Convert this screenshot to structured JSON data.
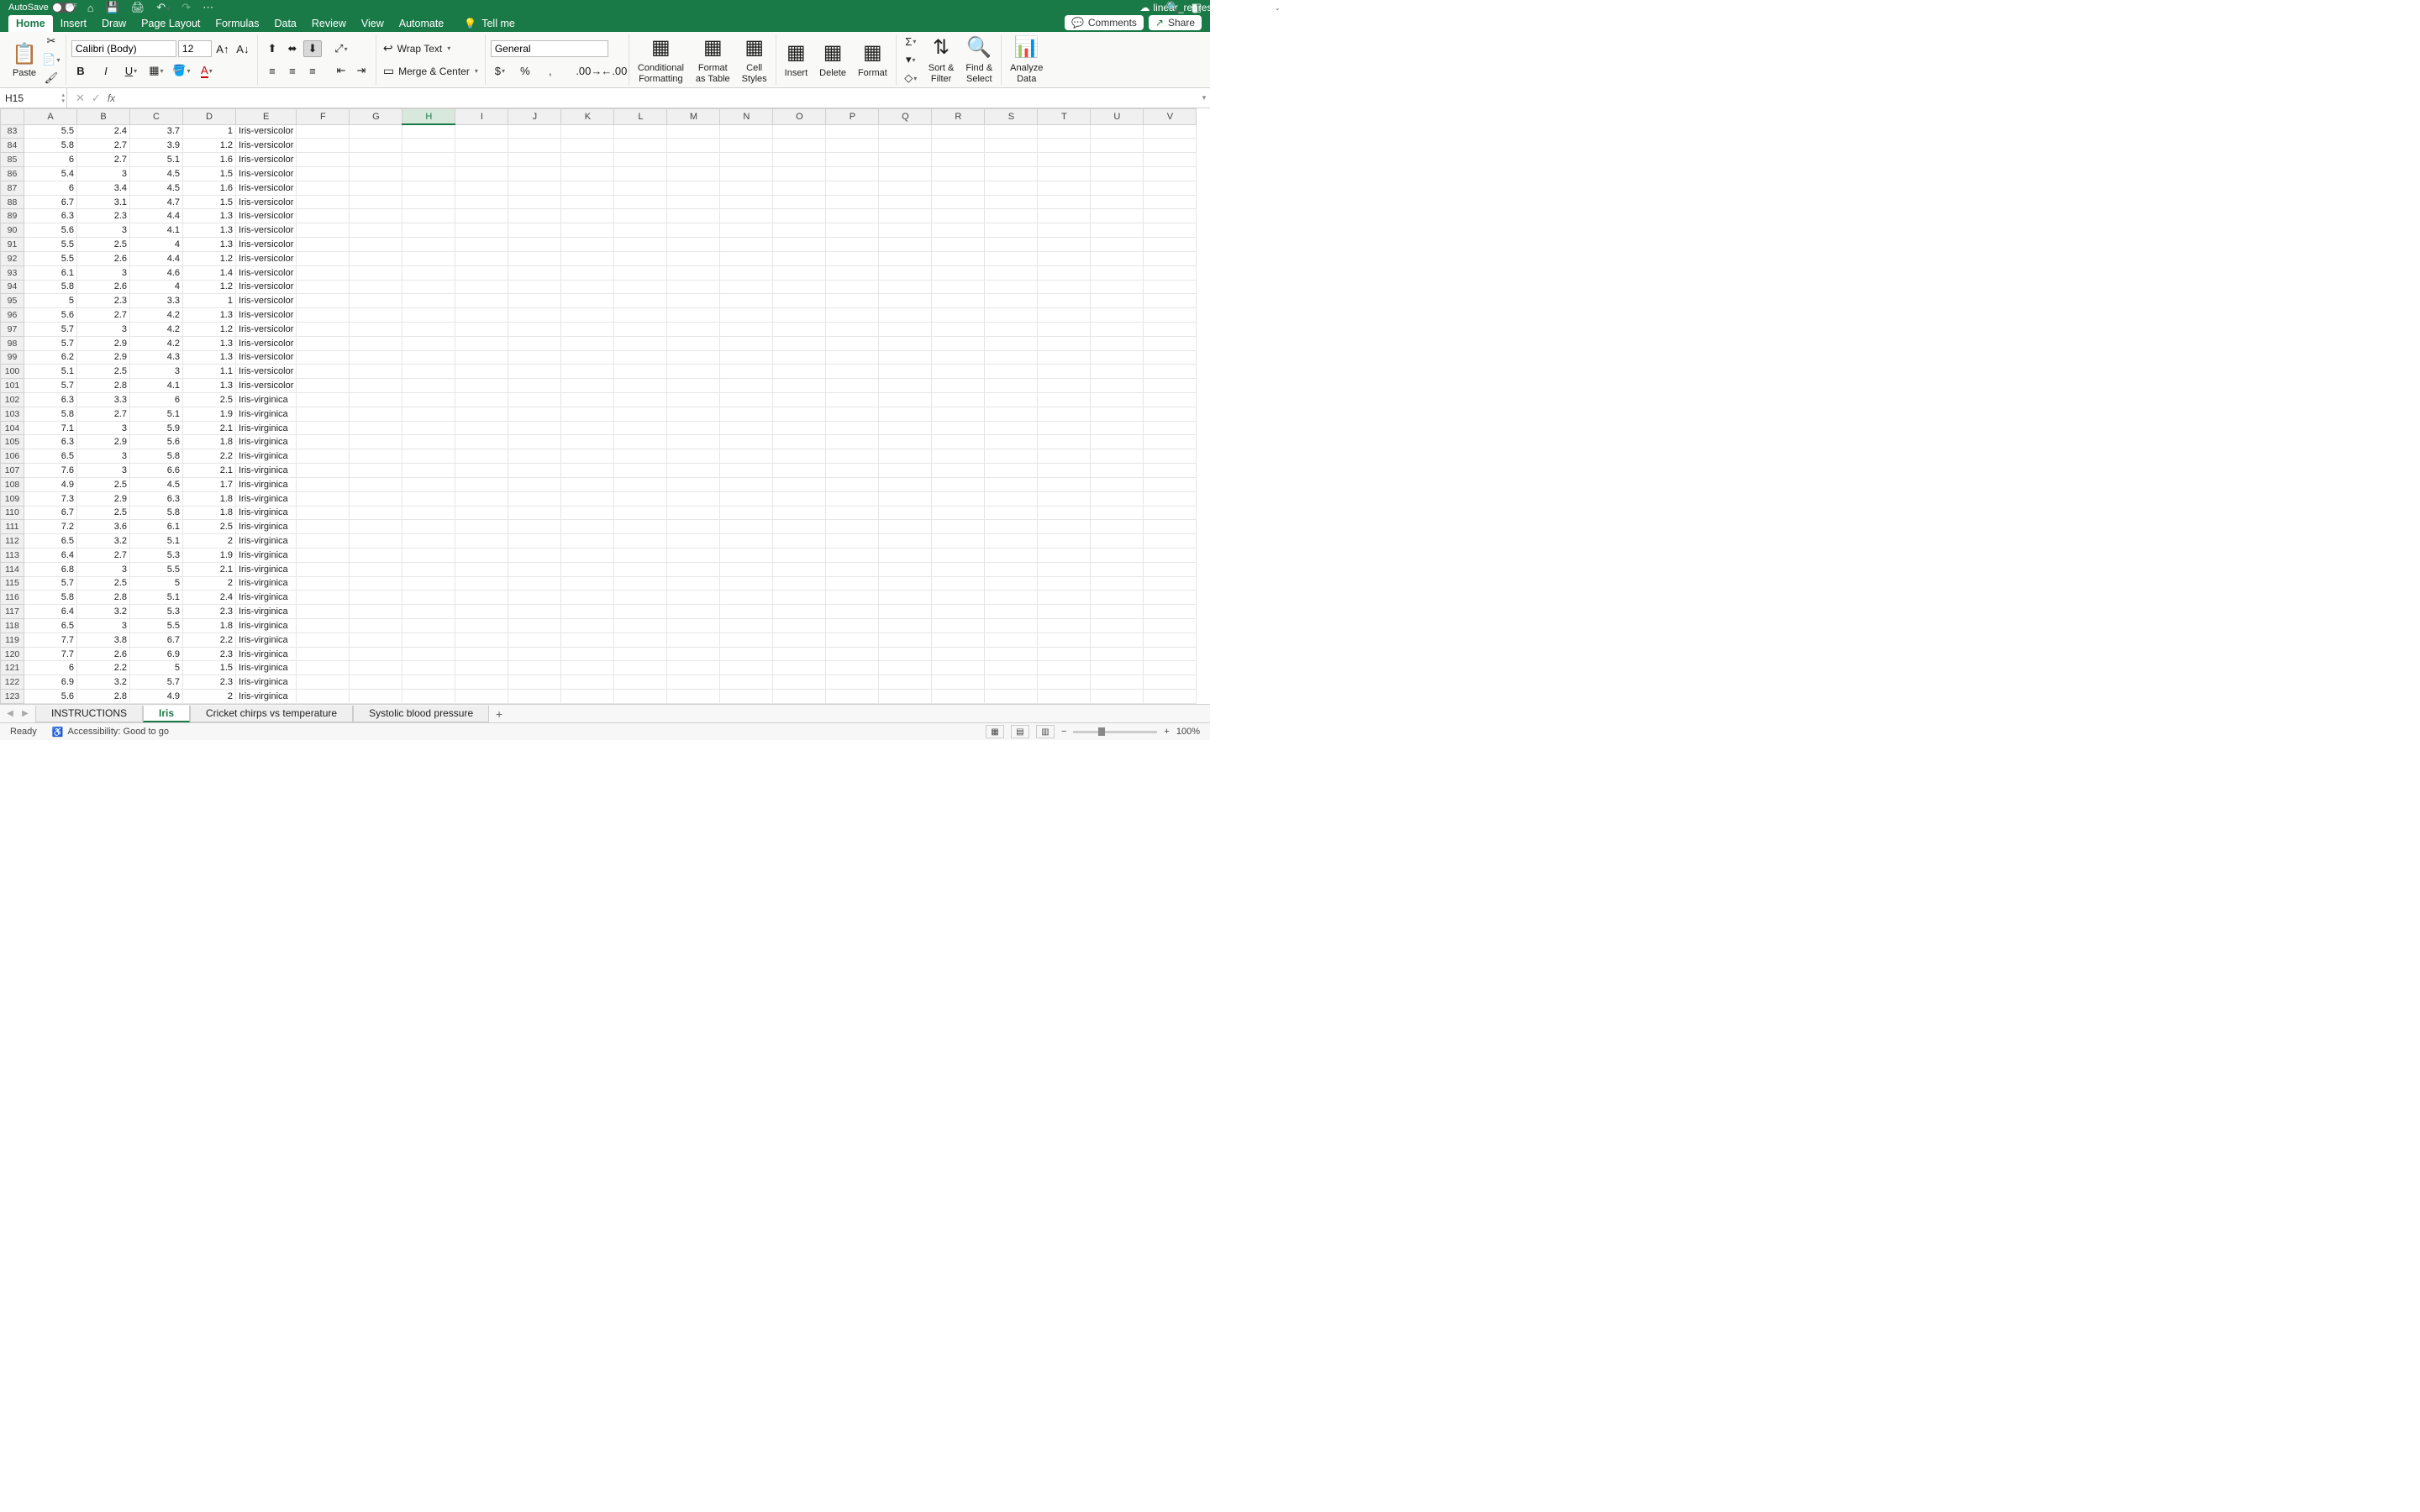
{
  "titlebar": {
    "autosave": "AutoSave",
    "toggle": "OFF",
    "filename": "linear_regression-updated"
  },
  "tabs": [
    "Home",
    "Insert",
    "Draw",
    "Page Layout",
    "Formulas",
    "Data",
    "Review",
    "View",
    "Automate"
  ],
  "tabs_active": 0,
  "tellme": "Tell me",
  "comments": "Comments",
  "share": "Share",
  "ribbon": {
    "paste": "Paste",
    "font": "Calibri (Body)",
    "size": "12",
    "wrap": "Wrap Text",
    "merge": "Merge & Center",
    "numformat": "General",
    "cond": "Conditional\nFormatting",
    "fmt_table": "Format\nas Table",
    "cell_styles": "Cell\nStyles",
    "insert": "Insert",
    "delete": "Delete",
    "format": "Format",
    "sort": "Sort &\nFilter",
    "find": "Find &\nSelect",
    "analyze": "Analyze\nData"
  },
  "namebox": "H15",
  "columns": [
    "A",
    "B",
    "C",
    "D",
    "E",
    "F",
    "G",
    "H",
    "I",
    "J",
    "K",
    "L",
    "M",
    "N",
    "O",
    "P",
    "Q",
    "R",
    "S",
    "T",
    "U",
    "V"
  ],
  "sel_col": 7,
  "rows": [
    {
      "n": 83,
      "a": 5.5,
      "b": 2.4,
      "c": 3.7,
      "d": 1,
      "e": "Iris-versicolor"
    },
    {
      "n": 84,
      "a": 5.8,
      "b": 2.7,
      "c": 3.9,
      "d": 1.2,
      "e": "Iris-versicolor"
    },
    {
      "n": 85,
      "a": 6,
      "b": 2.7,
      "c": 5.1,
      "d": 1.6,
      "e": "Iris-versicolor"
    },
    {
      "n": 86,
      "a": 5.4,
      "b": 3,
      "c": 4.5,
      "d": 1.5,
      "e": "Iris-versicolor"
    },
    {
      "n": 87,
      "a": 6,
      "b": 3.4,
      "c": 4.5,
      "d": 1.6,
      "e": "Iris-versicolor"
    },
    {
      "n": 88,
      "a": 6.7,
      "b": 3.1,
      "c": 4.7,
      "d": 1.5,
      "e": "Iris-versicolor"
    },
    {
      "n": 89,
      "a": 6.3,
      "b": 2.3,
      "c": 4.4,
      "d": 1.3,
      "e": "Iris-versicolor"
    },
    {
      "n": 90,
      "a": 5.6,
      "b": 3,
      "c": 4.1,
      "d": 1.3,
      "e": "Iris-versicolor"
    },
    {
      "n": 91,
      "a": 5.5,
      "b": 2.5,
      "c": 4,
      "d": 1.3,
      "e": "Iris-versicolor"
    },
    {
      "n": 92,
      "a": 5.5,
      "b": 2.6,
      "c": 4.4,
      "d": 1.2,
      "e": "Iris-versicolor"
    },
    {
      "n": 93,
      "a": 6.1,
      "b": 3,
      "c": 4.6,
      "d": 1.4,
      "e": "Iris-versicolor"
    },
    {
      "n": 94,
      "a": 5.8,
      "b": 2.6,
      "c": 4,
      "d": 1.2,
      "e": "Iris-versicolor"
    },
    {
      "n": 95,
      "a": 5,
      "b": 2.3,
      "c": 3.3,
      "d": 1,
      "e": "Iris-versicolor"
    },
    {
      "n": 96,
      "a": 5.6,
      "b": 2.7,
      "c": 4.2,
      "d": 1.3,
      "e": "Iris-versicolor"
    },
    {
      "n": 97,
      "a": 5.7,
      "b": 3,
      "c": 4.2,
      "d": 1.2,
      "e": "Iris-versicolor"
    },
    {
      "n": 98,
      "a": 5.7,
      "b": 2.9,
      "c": 4.2,
      "d": 1.3,
      "e": "Iris-versicolor"
    },
    {
      "n": 99,
      "a": 6.2,
      "b": 2.9,
      "c": 4.3,
      "d": 1.3,
      "e": "Iris-versicolor"
    },
    {
      "n": 100,
      "a": 5.1,
      "b": 2.5,
      "c": 3,
      "d": 1.1,
      "e": "Iris-versicolor"
    },
    {
      "n": 101,
      "a": 5.7,
      "b": 2.8,
      "c": 4.1,
      "d": 1.3,
      "e": "Iris-versicolor"
    },
    {
      "n": 102,
      "a": 6.3,
      "b": 3.3,
      "c": 6,
      "d": 2.5,
      "e": "Iris-virginica"
    },
    {
      "n": 103,
      "a": 5.8,
      "b": 2.7,
      "c": 5.1,
      "d": 1.9,
      "e": "Iris-virginica"
    },
    {
      "n": 104,
      "a": 7.1,
      "b": 3,
      "c": 5.9,
      "d": 2.1,
      "e": "Iris-virginica"
    },
    {
      "n": 105,
      "a": 6.3,
      "b": 2.9,
      "c": 5.6,
      "d": 1.8,
      "e": "Iris-virginica"
    },
    {
      "n": 106,
      "a": 6.5,
      "b": 3,
      "c": 5.8,
      "d": 2.2,
      "e": "Iris-virginica"
    },
    {
      "n": 107,
      "a": 7.6,
      "b": 3,
      "c": 6.6,
      "d": 2.1,
      "e": "Iris-virginica"
    },
    {
      "n": 108,
      "a": 4.9,
      "b": 2.5,
      "c": 4.5,
      "d": 1.7,
      "e": "Iris-virginica"
    },
    {
      "n": 109,
      "a": 7.3,
      "b": 2.9,
      "c": 6.3,
      "d": 1.8,
      "e": "Iris-virginica"
    },
    {
      "n": 110,
      "a": 6.7,
      "b": 2.5,
      "c": 5.8,
      "d": 1.8,
      "e": "Iris-virginica"
    },
    {
      "n": 111,
      "a": 7.2,
      "b": 3.6,
      "c": 6.1,
      "d": 2.5,
      "e": "Iris-virginica"
    },
    {
      "n": 112,
      "a": 6.5,
      "b": 3.2,
      "c": 5.1,
      "d": 2,
      "e": "Iris-virginica"
    },
    {
      "n": 113,
      "a": 6.4,
      "b": 2.7,
      "c": 5.3,
      "d": 1.9,
      "e": "Iris-virginica"
    },
    {
      "n": 114,
      "a": 6.8,
      "b": 3,
      "c": 5.5,
      "d": 2.1,
      "e": "Iris-virginica"
    },
    {
      "n": 115,
      "a": 5.7,
      "b": 2.5,
      "c": 5,
      "d": 2,
      "e": "Iris-virginica"
    },
    {
      "n": 116,
      "a": 5.8,
      "b": 2.8,
      "c": 5.1,
      "d": 2.4,
      "e": "Iris-virginica"
    },
    {
      "n": 117,
      "a": 6.4,
      "b": 3.2,
      "c": 5.3,
      "d": 2.3,
      "e": "Iris-virginica"
    },
    {
      "n": 118,
      "a": 6.5,
      "b": 3,
      "c": 5.5,
      "d": 1.8,
      "e": "Iris-virginica"
    },
    {
      "n": 119,
      "a": 7.7,
      "b": 3.8,
      "c": 6.7,
      "d": 2.2,
      "e": "Iris-virginica"
    },
    {
      "n": 120,
      "a": 7.7,
      "b": 2.6,
      "c": 6.9,
      "d": 2.3,
      "e": "Iris-virginica"
    },
    {
      "n": 121,
      "a": 6,
      "b": 2.2,
      "c": 5,
      "d": 1.5,
      "e": "Iris-virginica"
    },
    {
      "n": 122,
      "a": 6.9,
      "b": 3.2,
      "c": 5.7,
      "d": 2.3,
      "e": "Iris-virginica"
    },
    {
      "n": 123,
      "a": 5.6,
      "b": 2.8,
      "c": 4.9,
      "d": 2,
      "e": "Iris-virginica"
    }
  ],
  "sheets": [
    "INSTRUCTIONS",
    "Iris",
    "Cricket chirps vs temperature",
    "Systolic blood pressure"
  ],
  "sheet_active": 1,
  "status": {
    "ready": "Ready",
    "acc": "Accessibility: Good to go",
    "zoom": "100%"
  }
}
